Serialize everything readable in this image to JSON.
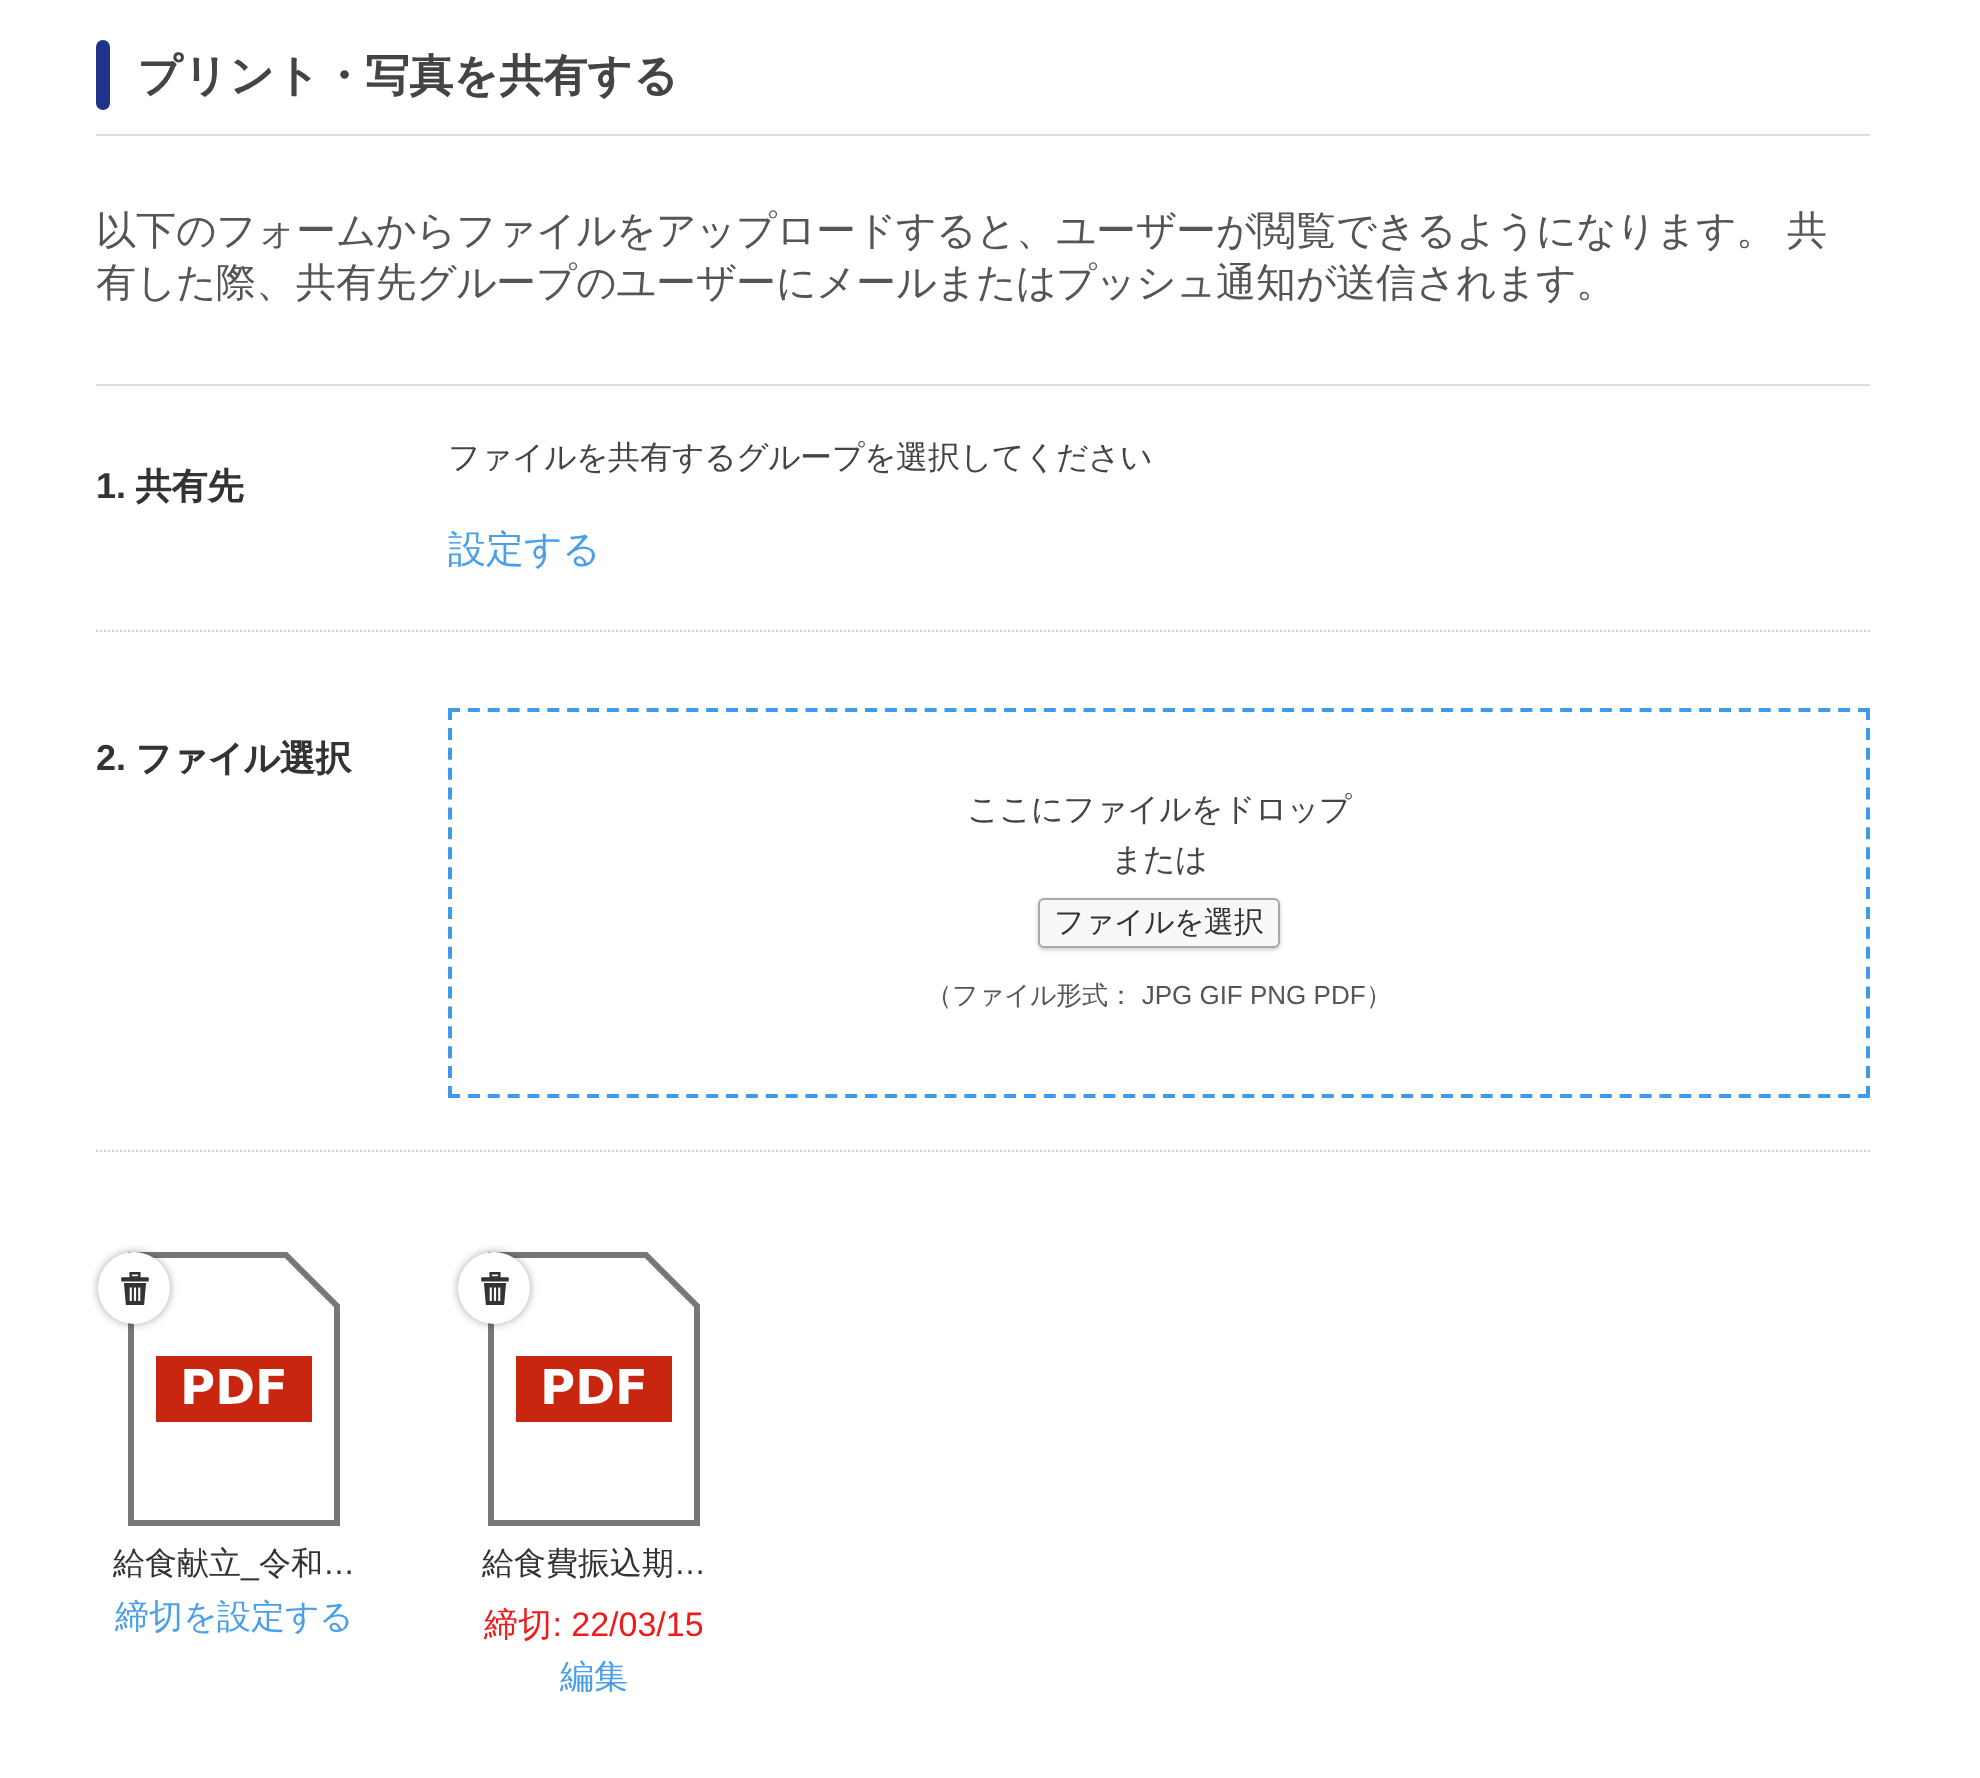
{
  "page": {
    "title": "プリント・写真を共有する"
  },
  "description": "以下のフォームからファイルをアップロードすると、ユーザーが閲覧できるようになります。 共有した際、共有先グループのユーザーにメールまたはプッシュ通知が送信されます。",
  "sections": [
    {
      "kind": "recipient",
      "label": "1. 共有先",
      "hint": "ファイルを共有するグループを選択してください",
      "link": "設定する"
    },
    {
      "kind": "upload",
      "label": "2. ファイル選択",
      "drop_text": "ここにファイルをドロップ",
      "or_text": "または",
      "button": "ファイルを選択",
      "formats": "（ファイル形式： JPG GIF PNG PDF）"
    }
  ],
  "files": [
    {
      "type_label": "PDF",
      "name": "給食献立_令和…",
      "deadline_link": "締切を設定する"
    },
    {
      "type_label": "PDF",
      "name": "給食費振込期…",
      "deadline": "締切: 22/03/15",
      "edit_link": "編集"
    }
  ]
}
